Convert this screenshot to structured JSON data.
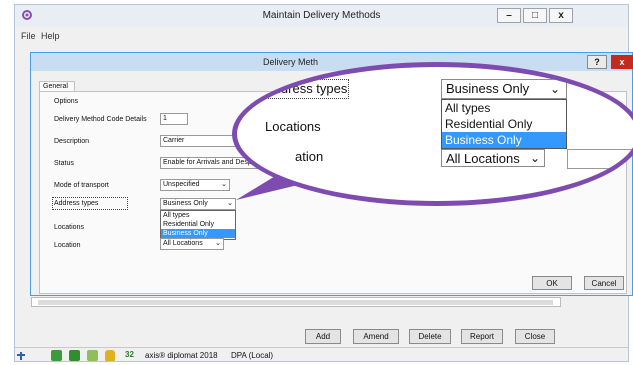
{
  "main_window": {
    "title": "Maintain Delivery Methods",
    "menu": [
      "File",
      "Help"
    ],
    "window_buttons": {
      "minimize": "–",
      "maximize": "□",
      "close": "x"
    }
  },
  "toolbar": {
    "add": "Add",
    "amend": "Amend",
    "delete": "Delete",
    "report": "Report",
    "close": "Close"
  },
  "statusbar": {
    "count": "32",
    "product": "axis® diplomat 2018",
    "database": "DPA (Local)"
  },
  "dialog": {
    "title": "Delivery Meth",
    "help_button": "?",
    "close_button": "x",
    "tab": "General",
    "options_group": "Options",
    "labels": {
      "code": "Delivery Method Code Details",
      "description": "Description",
      "status": "Status",
      "mode": "Mode of transport",
      "address_types": "Address types"
    },
    "values": {
      "code": "1",
      "description": "Carrier",
      "status": "Enable for Arrivals and Despatches",
      "mode": "Unspecified",
      "address_types": "Business Only"
    },
    "address_type_options": [
      "All types",
      "Residential Only",
      "Business Only"
    ],
    "locations_group": "Locations",
    "location_label": "Location",
    "location_value": "All Locations",
    "ok": "OK",
    "cancel": "Cancel"
  },
  "callout": {
    "address_types_label": "Address types",
    "address_types_value": "Business Only",
    "options": [
      "All types",
      "Residential Only",
      "Business Only"
    ],
    "locations_label": "Locations",
    "location_partial": "ation",
    "location_value": "All Locations"
  },
  "colors": {
    "callout_border": "#7e4bb1",
    "selection": "#3399ff",
    "dialog_border": "#4a9de0",
    "close_red": "#c42b1c"
  }
}
